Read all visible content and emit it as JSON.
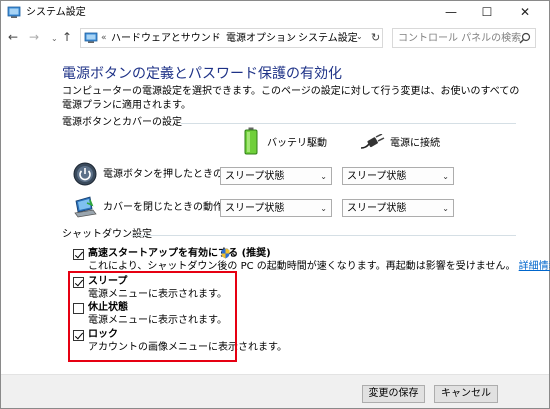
{
  "window": {
    "title": "システム設定",
    "controls": {
      "minimize": "—",
      "maximize": "☐",
      "close": "✕"
    }
  },
  "nav": {
    "back": "←",
    "forward": "→",
    "recent": "⌄",
    "up": "↑",
    "breadcrumb": {
      "overflow": "«",
      "segments": [
        "ハードウェアとサウンド",
        "電源オプション",
        "システム設定"
      ],
      "separator": "›",
      "dropdown": "⌄",
      "refresh": "↻"
    },
    "search": {
      "placeholder": "コントロール パネルの検索"
    }
  },
  "main": {
    "title": "電源ボタンの定義とパスワード保護の有効化",
    "description": "コンピューターの電源設定を選択できます。このページの設定に対して行う変更は、お使いのすべての電源プランに適用されます。",
    "power_section": {
      "heading": "電源ボタンとカバーの設定",
      "columns": {
        "battery": "バッテリ駆動",
        "plugged_in": "電源に接続"
      },
      "rows": [
        {
          "label": "電源ボタンを押したときの動作:",
          "battery": "スリープ状態",
          "plugged_in": "スリープ状態"
        },
        {
          "label": "カバーを閉じたときの動作:",
          "battery": "スリープ状態",
          "plugged_in": "スリープ状態"
        }
      ],
      "select_arrow": "⌄"
    },
    "shutdown_section": {
      "heading": "シャットダウン設定",
      "options": [
        {
          "label": "高速スタートアップを有効にする (推奨)",
          "description": "これにより、シャットダウン後の PC の起動時間が速くなります。再起動は影響を受けません。",
          "link": "詳細情報",
          "checked": true
        },
        {
          "label": "スリープ",
          "description": "電源メニューに表示されます。",
          "checked": true
        },
        {
          "label": "休止状態",
          "description": "電源メニューに表示されます。",
          "checked": false
        },
        {
          "label": "ロック",
          "description": "アカウントの画像メニューに表示されます。",
          "checked": true
        }
      ]
    }
  },
  "footer": {
    "save_label": "変更の保存",
    "cancel_label": "キャンセル"
  },
  "colors": {
    "title_blue": "#1e3287",
    "highlight_red": "#e60012",
    "link_blue": "#0066cc",
    "footer_bg": "#f0f0f0"
  }
}
